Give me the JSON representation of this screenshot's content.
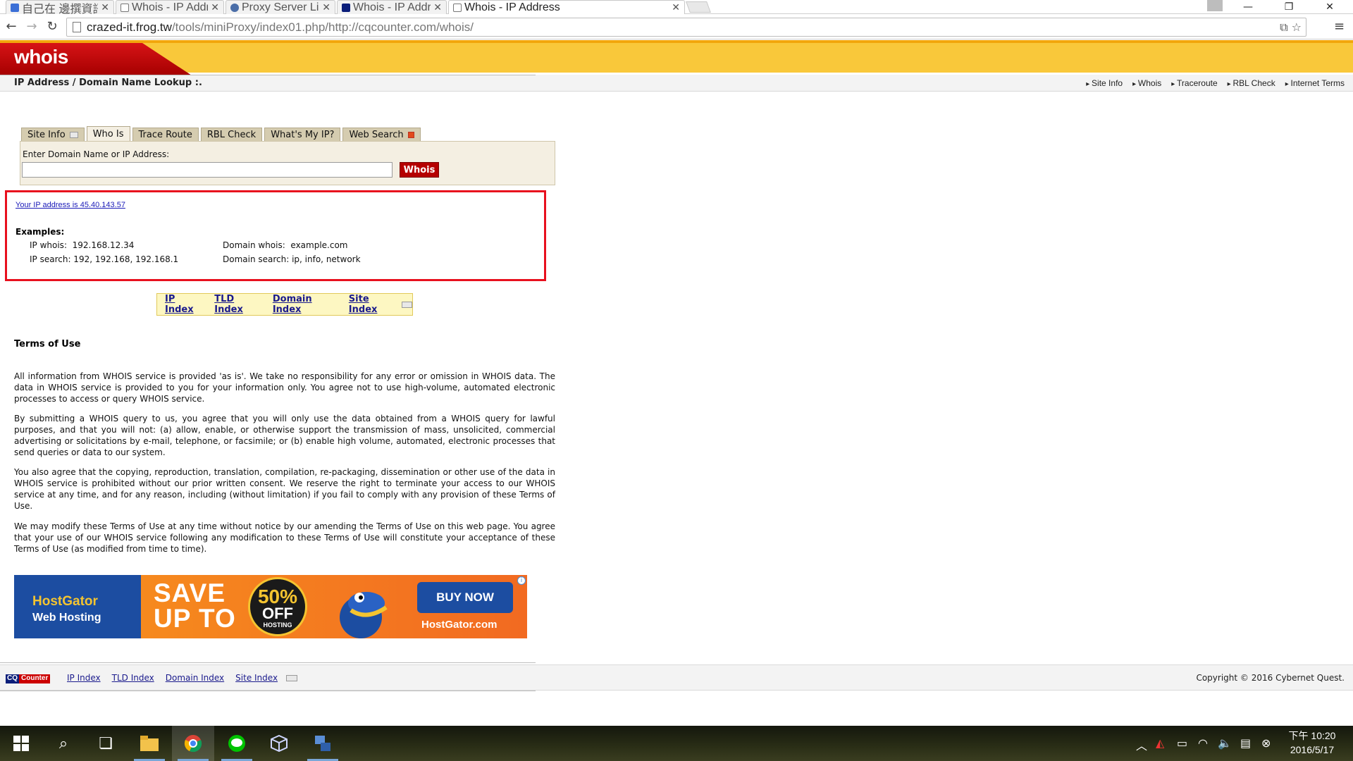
{
  "browser": {
    "tabs": [
      {
        "title": "自己在 邊撰資訊 虛",
        "active": false
      },
      {
        "title": "Whois - IP Address",
        "active": false
      },
      {
        "title": "Proxy Server List - L",
        "active": false
      },
      {
        "title": "Whois - IP Address",
        "active": false
      },
      {
        "title": "Whois - IP Address",
        "active": true
      }
    ],
    "url_host": "crazed-it.frog.tw",
    "url_path": "/tools/miniProxy/index01.php/http://cqcounter.com/whois/"
  },
  "header": {
    "logo": "whois",
    "subtitle": "IP Address / Domain Name Lookup :.",
    "nav": [
      "Site Info",
      "Whois",
      "Traceroute",
      "RBL Check",
      "Internet Terms"
    ]
  },
  "tabs": [
    "Site Info",
    "Who Is",
    "Trace Route",
    "RBL Check",
    "What's My IP?",
    "Web Search"
  ],
  "search": {
    "label": "Enter Domain Name or IP Address:",
    "value": "",
    "button": "Whois"
  },
  "result": {
    "ip_line": "Your IP address is 45.40.143.57",
    "examples_title": "Examples:",
    "ip_whois": "IP whois:  192.168.12.34",
    "ip_search": "IP search: 192, 192.168, 192.168.1",
    "domain_whois": "Domain whois:  example.com",
    "domain_search": "Domain search: ip, info, network"
  },
  "index_links": [
    "IP Index",
    "TLD Index",
    "Domain Index",
    "Site Index"
  ],
  "terms": {
    "title": "Terms of Use",
    "paragraphs": [
      "All information from WHOIS service is provided 'as is'. We take no responsibility for any error or omission in WHOIS data. The data in WHOIS service is provided to you for your information only. You agree not to use high-volume, automated electronic processes to access or query WHOIS service.",
      "By submitting a WHOIS query to us, you agree that you will only use the data obtained from a WHOIS query for lawful purposes, and that you will not: (a) allow, enable, or otherwise support the transmission of mass, unsolicited, commercial advertising or solicitations by e-mail, telephone, or facsimile; or (b) enable high volume, automated, electronic processes that send queries or data to our system.",
      "You also agree that the copying, reproduction, translation, compilation, re-packaging, dissemination or other use of the data in WHOIS service is prohibited without our prior written consent. We reserve the right to terminate your access to our WHOIS service at any time, and for any reason, including (without limitation) if you fail to comply with any provision of these Terms of Use.",
      "We may modify these Terms of Use at any time without notice by our amending the Terms of Use on this web page. You agree that your use of our WHOIS service following any modification to these Terms of Use will constitute your acceptance of these Terms of Use (as modified from time to time)."
    ]
  },
  "ad": {
    "brand": "HostGator",
    "brand_sub": "Web Hosting",
    "save_line1": "SAVE",
    "save_line2": "UP TO",
    "pct": "50%",
    "off": "OFF",
    "hosting": "HOSTING",
    "buy": "BUY NOW",
    "url": "HostGator.com"
  },
  "footer": {
    "logo_a": "CQ",
    "logo_b": "Counter",
    "links": [
      "IP Index",
      "TLD Index",
      "Domain Index",
      "Site Index"
    ],
    "copyright": "Copyright © 2016 Cybernet Quest."
  },
  "taskbar": {
    "time": "下午 10:20",
    "date": "2016/5/17"
  },
  "colors": {
    "header_yellow": "#f9c83a",
    "logo_red": "#c40d10",
    "highlight_box": "#e8101e",
    "whois_button": "#b50000"
  },
  "icons": [
    "back-arrow-icon",
    "forward-arrow-icon",
    "reload-icon",
    "page-icon",
    "translate-icon",
    "star-icon",
    "menu-icon",
    "windows-start-icon",
    "search-icon",
    "task-view-icon",
    "file-explorer-icon",
    "chrome-icon",
    "line-app-icon",
    "box-app-icon",
    "network-app-icon"
  ]
}
